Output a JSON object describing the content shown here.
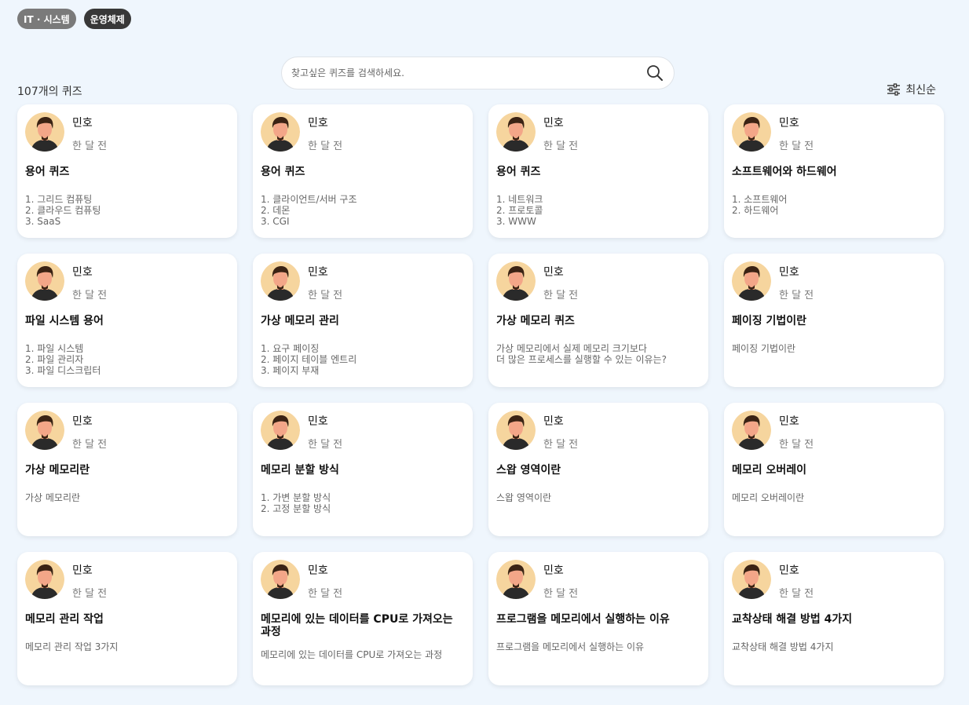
{
  "tags": [
    {
      "label": "IT · 시스템"
    },
    {
      "label": "운영체제"
    }
  ],
  "search": {
    "placeholder": "찾고싶은 퀴즈를 검색하세요."
  },
  "count_label": "107개의 퀴즈",
  "sort": {
    "label": "최신순",
    "icon": "filter-icon"
  },
  "colors": {
    "background": "#eff6fd",
    "tag_gray": "#7a7a7a",
    "tag_dark": "#383838",
    "avatar_bg": "#f6d59e"
  },
  "cards": [
    {
      "author": "민호",
      "time": "한 달 전",
      "title": "용어 퀴즈",
      "desc": "1. 그리드 컴퓨팅\n2. 클라우드 컴퓨팅\n3. SaaS"
    },
    {
      "author": "민호",
      "time": "한 달 전",
      "title": "용어 퀴즈",
      "desc": "1. 클라이언트/서버 구조\n2. 데몬\n3. CGI"
    },
    {
      "author": "민호",
      "time": "한 달 전",
      "title": "용어 퀴즈",
      "desc": "1. 네트워크\n2. 프로토콜\n3. WWW"
    },
    {
      "author": "민호",
      "time": "한 달 전",
      "title": "소프트웨어와 하드웨어",
      "desc": "1. 소프트웨어\n2. 하드웨어"
    },
    {
      "author": "민호",
      "time": "한 달 전",
      "title": "파일 시스템 용어",
      "desc": "1. 파일 시스템\n2. 파일 관리자\n3. 파일 디스크립터"
    },
    {
      "author": "민호",
      "time": "한 달 전",
      "title": "가상 메모리 관리",
      "desc": "1. 요구 페이징\n2. 페이지 테이블 엔트리\n3. 페이지 부재"
    },
    {
      "author": "민호",
      "time": "한 달 전",
      "title": "가상 메모리 퀴즈",
      "desc": "가상 메모리에서 실제 메모리 크기보다\n더 많은 프로세스를 실행할 수 있는 이유는?"
    },
    {
      "author": "민호",
      "time": "한 달 전",
      "title": "페이징 기법이란",
      "desc": "페이징 기법이란"
    },
    {
      "author": "민호",
      "time": "한 달 전",
      "title": "가상 메모리란",
      "desc": "가상 메모리란"
    },
    {
      "author": "민호",
      "time": "한 달 전",
      "title": "메모리 분할 방식",
      "desc": "1. 가변 분할 방식\n2. 고정 분할 방식"
    },
    {
      "author": "민호",
      "time": "한 달 전",
      "title": "스왑 영역이란",
      "desc": "스왑 영역이란"
    },
    {
      "author": "민호",
      "time": "한 달 전",
      "title": "메모리 오버레이",
      "desc": "메모리 오버레이란"
    },
    {
      "author": "민호",
      "time": "한 달 전",
      "title": "메모리 관리 작업",
      "desc": "메모리 관리 작업 3가지"
    },
    {
      "author": "민호",
      "time": "한 달 전",
      "title": "메모리에 있는 데이터를 CPU로 가져오는 과정",
      "desc": "메모리에 있는 데이터를 CPU로 가져오는 과정"
    },
    {
      "author": "민호",
      "time": "한 달 전",
      "title": "프로그램을 메모리에서 실행하는 이유",
      "desc": "프로그램을 메모리에서 실행하는 이유"
    },
    {
      "author": "민호",
      "time": "한 달 전",
      "title": "교착상태 해결 방법 4가지",
      "desc": "교착상태 해결 방법 4가지"
    }
  ]
}
